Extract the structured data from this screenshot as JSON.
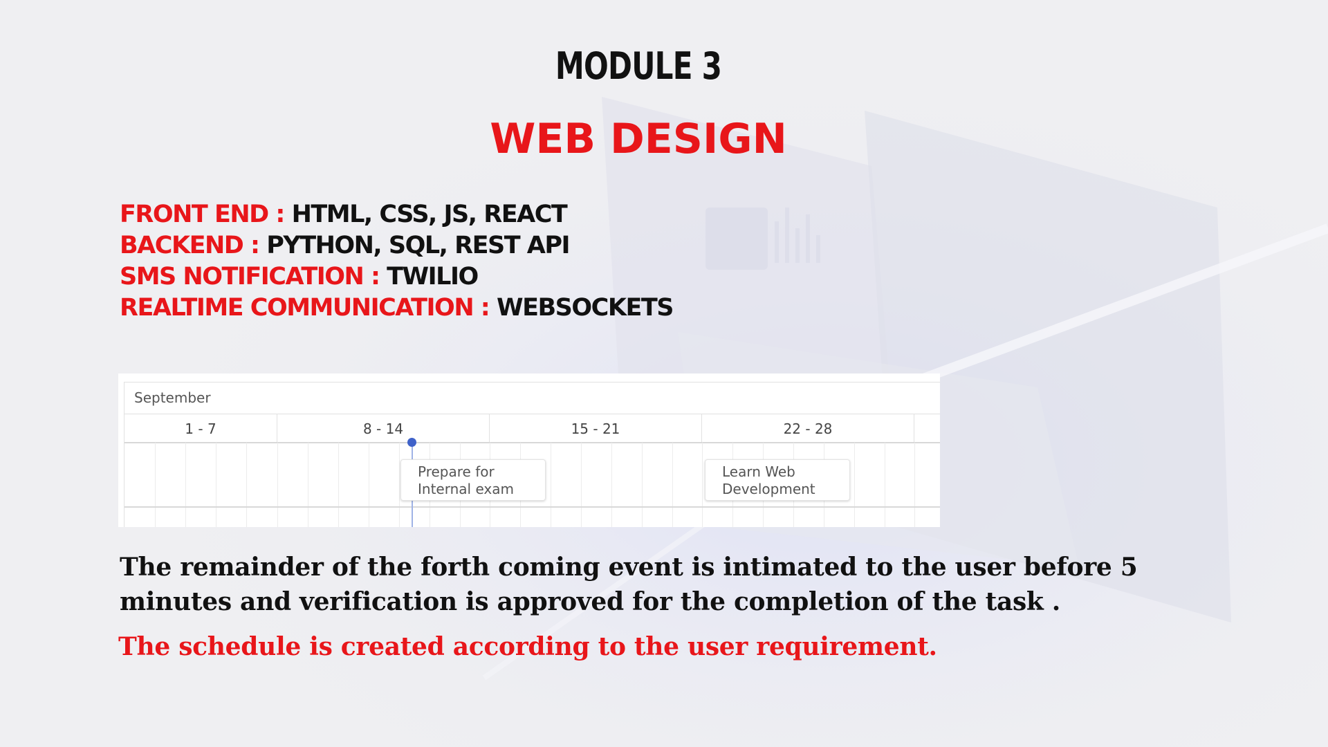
{
  "slide": {
    "module_title": "MODULE 3",
    "main_title": "WEB DESIGN",
    "tech_stack": [
      {
        "key": "FRONT END : ",
        "value": "HTML, CSS, JS, REACT"
      },
      {
        "key": "BACKEND : ",
        "value": "PYTHON, SQL, REST API"
      },
      {
        "key": "SMS NOTIFICATION : ",
        "value": "TWILIO"
      },
      {
        "key": "REALTIME COMMUNICATION : ",
        "value": "WEBSOCKETS"
      }
    ],
    "description": "The remainder of the forth coming event is intimated to the user before 5 minutes and verification is approved for the completion of the task .",
    "note": "The schedule is created according to the user requirement."
  },
  "calendar": {
    "month": "September",
    "weeks": [
      "1 - 7",
      "8 - 14",
      "15 - 21",
      "22 - 28"
    ],
    "events": [
      {
        "title": "Prepare for\nInternal exam"
      },
      {
        "title": "Learn Web\nDevelopment"
      }
    ]
  },
  "colors": {
    "accent_red": "#e8161a",
    "text_dark": "#111111",
    "today_marker": "#3f62c9"
  }
}
